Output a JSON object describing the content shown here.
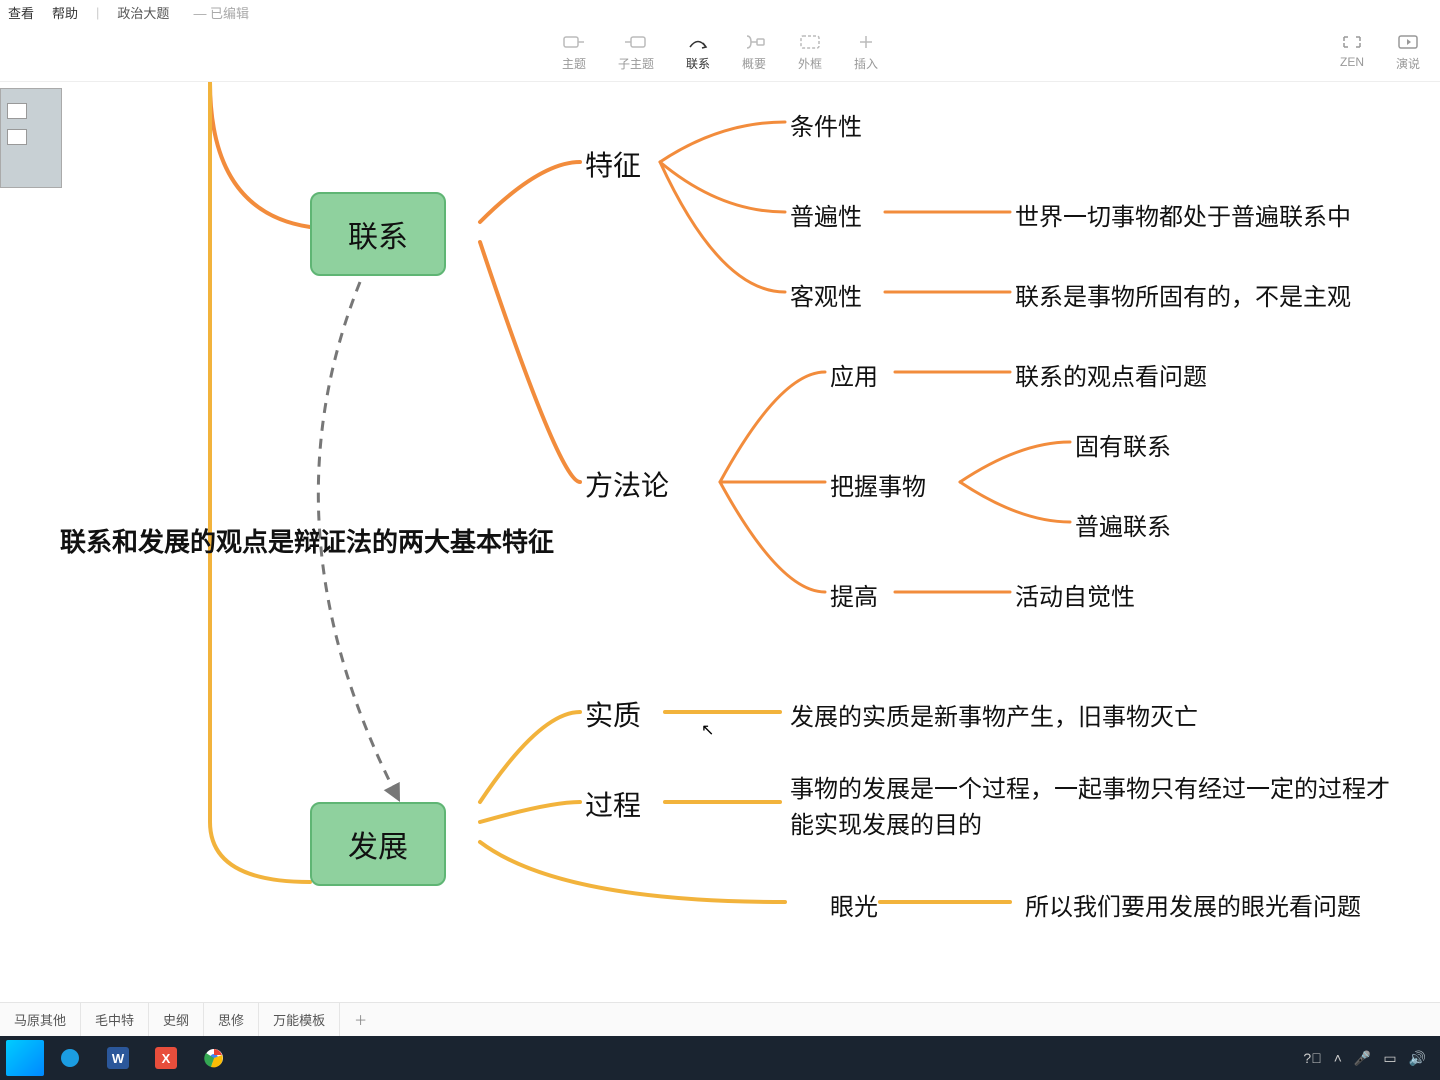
{
  "menu": {
    "view": "查看",
    "help": "帮助",
    "doc": "政治大题",
    "edited": "— 已编辑"
  },
  "toolbar": {
    "topic": "主题",
    "subtopic": "子主题",
    "relation": "联系",
    "summary": "概要",
    "boundary": "外框",
    "insert": "插入",
    "zen": "ZEN",
    "present": "演说"
  },
  "nodes": {
    "lianxi": "联系",
    "fazhan": "发展",
    "bold_text": "联系和发展的观点是辩证法的两大基本特征",
    "tezheng": "特征",
    "tiaojianxing": "条件性",
    "pubianxing": "普遍性",
    "pubianxing_desc": "世界一切事物都处于普遍联系中",
    "keguanxing": "客观性",
    "keguanxing_desc": "联系是事物所固有的，不是主观",
    "fangfalun": "方法论",
    "yingyong": "应用",
    "yingyong_desc": "联系的观点看问题",
    "bawoshiwu": "把握事物",
    "guyoulianxi": "固有联系",
    "pubianlianxi": "普遍联系",
    "tigao": "提高",
    "tigao_desc": "活动自觉性",
    "shizhi": "实质",
    "shizhi_desc": "发展的实质是新事物产生，旧事物灭亡",
    "guocheng": "过程",
    "guocheng_desc": "事物的发展是一个过程，一起事物只有经过一定的过程才能实现发展的目的",
    "yanguang": "眼光",
    "yanguang_desc": "所以我们要用发展的眼光看问题"
  },
  "tabs": {
    "t1": "马原其他",
    "t2": "毛中特",
    "t3": "史纲",
    "t4": "思修",
    "t5": "万能模板"
  }
}
